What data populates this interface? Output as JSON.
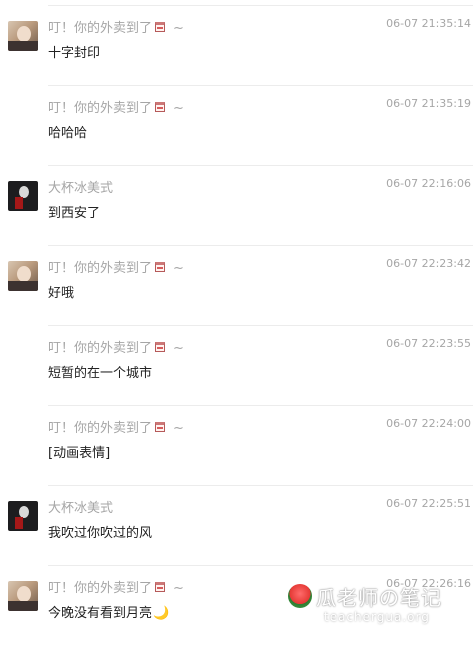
{
  "messages": [
    {
      "name": "叮！你的外卖到了",
      "avatar": "girl",
      "time": "06-07 21:35:14",
      "text": "十字封印"
    },
    {
      "name": "叮！你的外卖到了",
      "avatar": "",
      "time": "06-07 21:35:19",
      "text": "哈哈哈"
    },
    {
      "name": "大杯冰美式",
      "avatar": "boy",
      "time": "06-07 22:16:06",
      "text": "到西安了"
    },
    {
      "name": "叮！你的外卖到了",
      "avatar": "girl",
      "time": "06-07 22:23:42",
      "text": "好哦"
    },
    {
      "name": "叮！你的外卖到了",
      "avatar": "",
      "time": "06-07 22:23:55",
      "text": "短暂的在一个城市"
    },
    {
      "name": "叮！你的外卖到了",
      "avatar": "",
      "time": "06-07 22:24:00",
      "text": "[动画表情]"
    },
    {
      "name": "大杯冰美式",
      "avatar": "boy",
      "time": "06-07 22:25:51",
      "text": "我吹过你吹过的风"
    },
    {
      "name": "叮！你的外卖到了",
      "avatar": "girl",
      "time": "06-07 22:26:16",
      "text": "今晚没有看到月亮"
    }
  ],
  "name_suffix": "~",
  "moon_emoji": "🌙",
  "watermark": {
    "title": "瓜老师の笔记",
    "url": "teachergua.org"
  },
  "colors": {
    "name": "#a6a6a6",
    "time": "#a6a6a6",
    "text": "#222222",
    "divider": "#ececec"
  },
  "icons": {
    "name_decoration": "drink-cup-icon",
    "watermark_logo": "watermelon-icon"
  }
}
